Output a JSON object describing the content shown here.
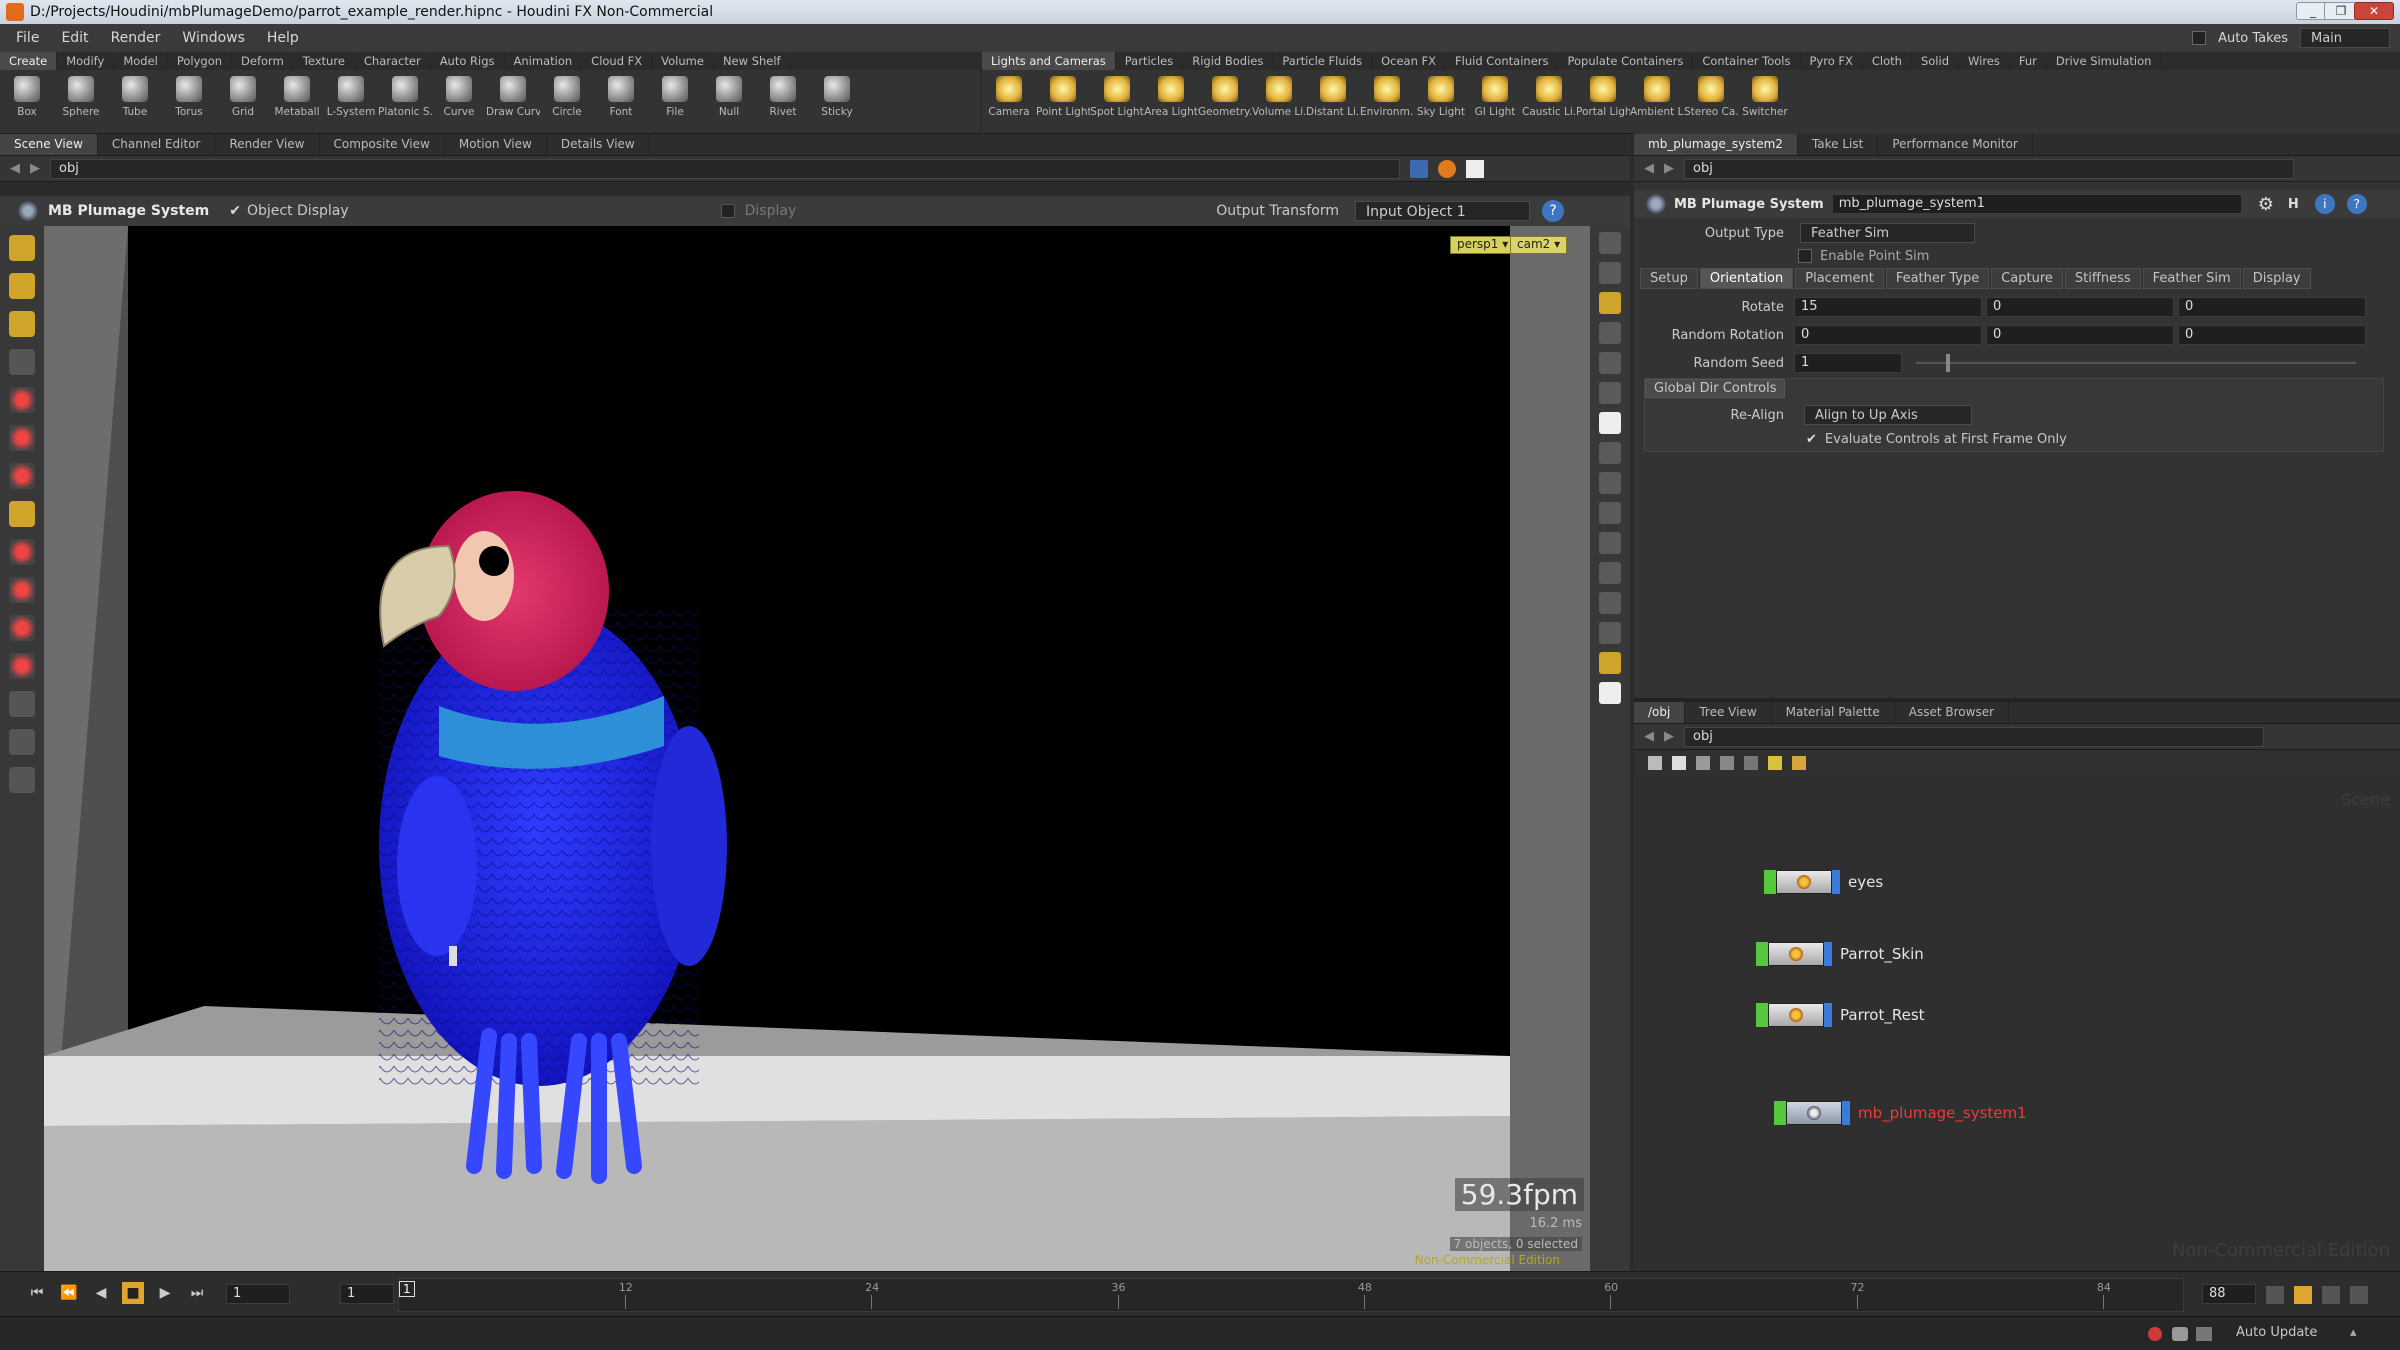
{
  "window": {
    "title": "D:/Projects/Houdini/mbPlumageDemo/parrot_example_render.hipnc - Houdini FX Non-Commercial",
    "minimize": "_",
    "maximize": "❐",
    "close": "✕"
  },
  "menubar": {
    "items": [
      "File",
      "Edit",
      "Render",
      "Windows",
      "Help"
    ],
    "auto_takes": "Auto Takes",
    "desktop": "Main"
  },
  "shelf_left": {
    "tabs": [
      "Create",
      "Modify",
      "Model",
      "Polygon",
      "Deform",
      "Texture",
      "Character",
      "Auto Rigs",
      "Animation",
      "Cloud FX",
      "Volume",
      "New Shelf"
    ],
    "tools": [
      "Box",
      "Sphere",
      "Tube",
      "Torus",
      "Grid",
      "Metaball",
      "L-System",
      "Platonic S...",
      "Curve",
      "Draw Curve",
      "Circle",
      "Font",
      "File",
      "Null",
      "Rivet",
      "Sticky"
    ]
  },
  "shelf_right": {
    "tabs": [
      "Lights and Cameras",
      "Particles",
      "Rigid Bodies",
      "Particle Fluids",
      "Ocean FX",
      "Fluid Containers",
      "Populate Containers",
      "Container Tools",
      "Pyro FX",
      "Cloth",
      "Solid",
      "Wires",
      "Fur",
      "Drive Simulation"
    ],
    "tools": [
      "Camera",
      "Point Light",
      "Spot Light",
      "Area Light",
      "Geometry...",
      "Volume Li...",
      "Distant Li...",
      "Environm...",
      "Sky Light",
      "GI Light",
      "Caustic Li...",
      "Portal Light",
      "Ambient L...",
      "Stereo Ca...",
      "Switcher"
    ]
  },
  "left_pane": {
    "tabs": [
      "Scene View",
      "Channel Editor",
      "Render View",
      "Composite View",
      "Motion View",
      "Details View"
    ],
    "path": "obj"
  },
  "viewport_header": {
    "title": "MB Plumage System",
    "object_display": "Object Display",
    "display": "Display",
    "output_transform_label": "Output Transform",
    "output_transform_value": "Input Object 1"
  },
  "viewport": {
    "cam_persp": "persp1 ▾",
    "cam_cam": "cam2 ▾",
    "fps": "59.3fpm",
    "ms": "16.2 ms",
    "selection": "7 objects, 0 selected",
    "edition": "Non-Commercial Edition"
  },
  "right_top_pane": {
    "tabs": [
      "mb_plumage_system2",
      "Take List",
      "Performance Monitor"
    ],
    "path": "obj"
  },
  "params": {
    "node_type": "MB Plumage System",
    "node_name": "mb_plumage_system1",
    "output_type_label": "Output Type",
    "output_type_value": "Feather Sim",
    "enable_point_sim": "Enable Point Sim",
    "tabs": [
      "Setup",
      "Orientation",
      "Placement",
      "Feather Type",
      "Capture",
      "Stiffness",
      "Feather Sim",
      "Display"
    ],
    "rotate_label": "Rotate",
    "rotate_values": [
      "15",
      "0",
      "0"
    ],
    "random_rotation_label": "Random Rotation",
    "random_rotation_values": [
      "0",
      "0",
      "0"
    ],
    "random_seed_label": "Random Seed",
    "random_seed_value": "1",
    "global_dir_controls": "Global Dir Controls",
    "realign_label": "Re-Align",
    "realign_value": "Align to Up Axis",
    "evaluate_controls": "Evaluate Controls at First Frame Only"
  },
  "network_pane": {
    "tabs": [
      "/obj",
      "Tree View",
      "Material Palette",
      "Asset Browser"
    ],
    "path": "obj",
    "watermark_scene": "Scene",
    "watermark_edition": "Non-Commercial Edition",
    "nodes": [
      "eyes",
      "Parrot_Skin",
      "Parrot_Rest",
      "mb_plumage_system1"
    ]
  },
  "timeline": {
    "start_frame": "1",
    "current_frame": "1",
    "marker": "1",
    "ticks": [
      "12",
      "24",
      "36",
      "48",
      "60",
      "72",
      "84"
    ],
    "end_frame": "88"
  },
  "statusbar": {
    "auto_update": "Auto Update"
  }
}
